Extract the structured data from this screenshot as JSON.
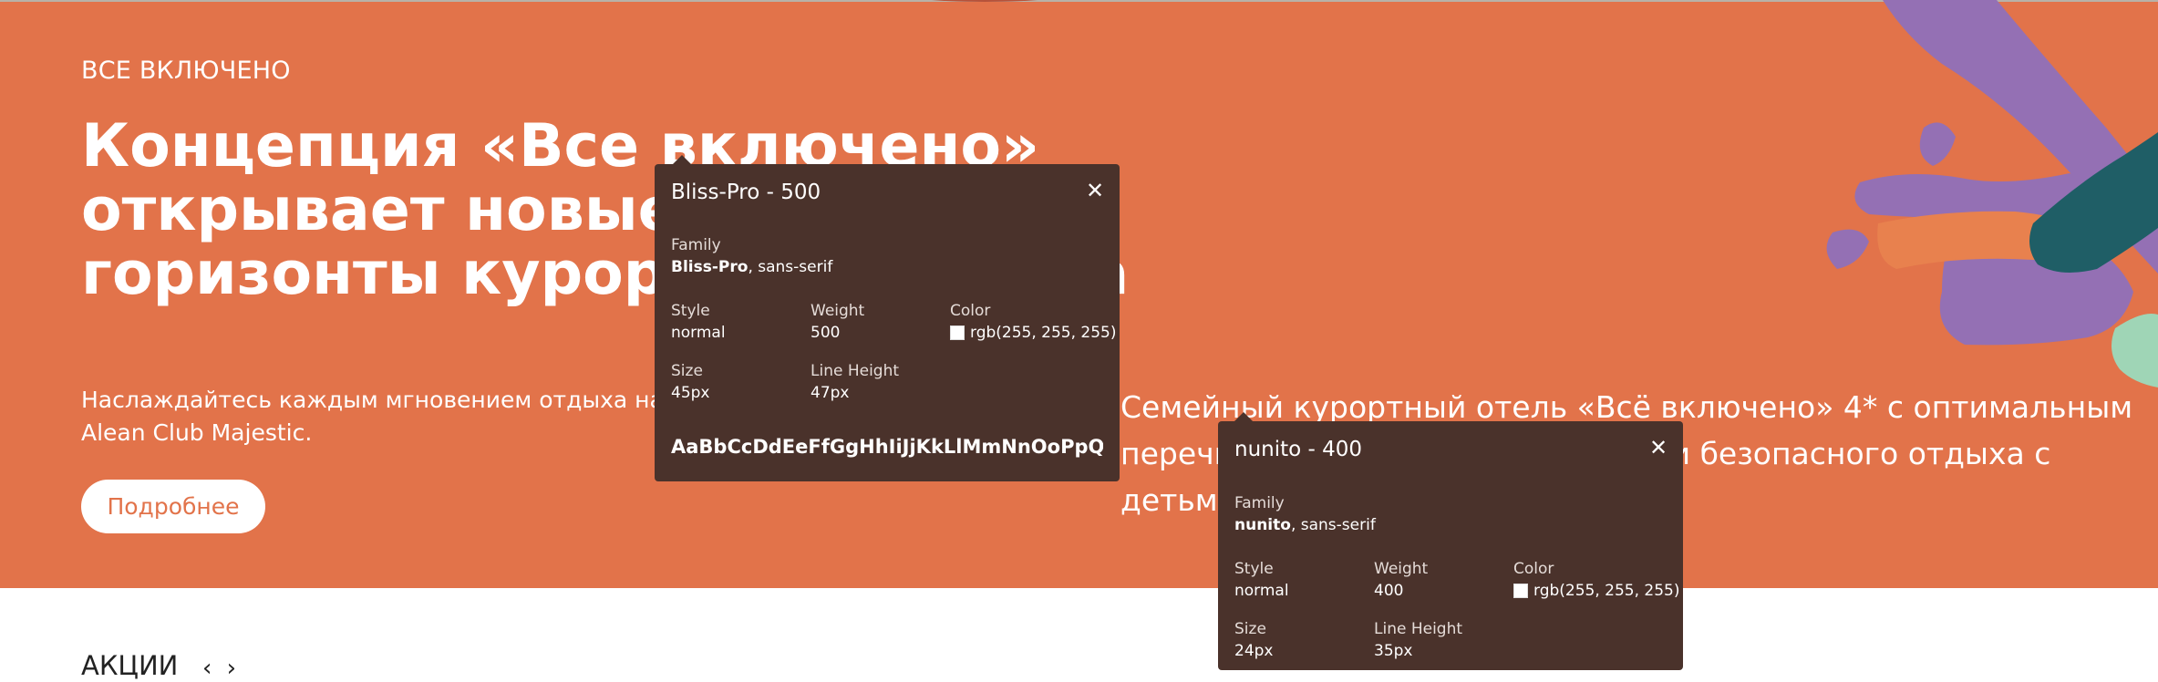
{
  "hero": {
    "eyebrow": "ВСЕ ВКЛЮЧЕНО",
    "headline_line1": "Концепция «Все включено» открывает новые",
    "headline_line2": "горизонты курортного отдыха",
    "lead_line1": "Наслаждайтесь каждым мгновением отдыха на курорте",
    "lead_line2": "Alean Club Majestic.",
    "more_button": "Подробнее",
    "side_text_line1": "Семейный курортный отель «Всё включено» 4* с оптимальным",
    "side_text_line2": "перечнем услуг для комфортного и безопасного отдыха с",
    "side_text_line3": "детьми"
  },
  "below": {
    "section_title": "АКЦИИ",
    "nav_arrows": "‹ ›"
  },
  "inspector_tooltips": [
    {
      "title": "Bliss-Pro - 500",
      "family_label": "Family",
      "family_name": "Bliss-Pro",
      "family_fallback": ", sans-serif",
      "style_label": "Style",
      "style_value": "normal",
      "weight_label": "Weight",
      "weight_value": "500",
      "color_label": "Color",
      "color_value": "rgb(255, 255, 255)",
      "size_label": "Size",
      "size_value": "45px",
      "line_height_label": "Line Height",
      "line_height_value": "47px",
      "sample": "AaBbCcDdEeFfGgHhIiJjKkLlMmNnOoPpQqRrSs"
    },
    {
      "title": "nunito - 400",
      "family_label": "Family",
      "family_name": "nunito",
      "family_fallback": ", sans-serif",
      "style_label": "Style",
      "style_value": "normal",
      "weight_label": "Weight",
      "weight_value": "400",
      "color_label": "Color",
      "color_value": "rgb(255, 255, 255)",
      "size_label": "Size",
      "size_value": "24px",
      "line_height_label": "Line Height",
      "line_height_value": "35px"
    }
  ],
  "colors": {
    "hero_bg": "#E2734A",
    "tooltip_bg": "#4a322b",
    "decor_purple": "#9470b4",
    "decor_teal": "#1f5e66",
    "decor_mint": "#9fd5b6"
  },
  "icons": {
    "close": "close-icon",
    "color_swatch": "color-swatch-icon"
  }
}
